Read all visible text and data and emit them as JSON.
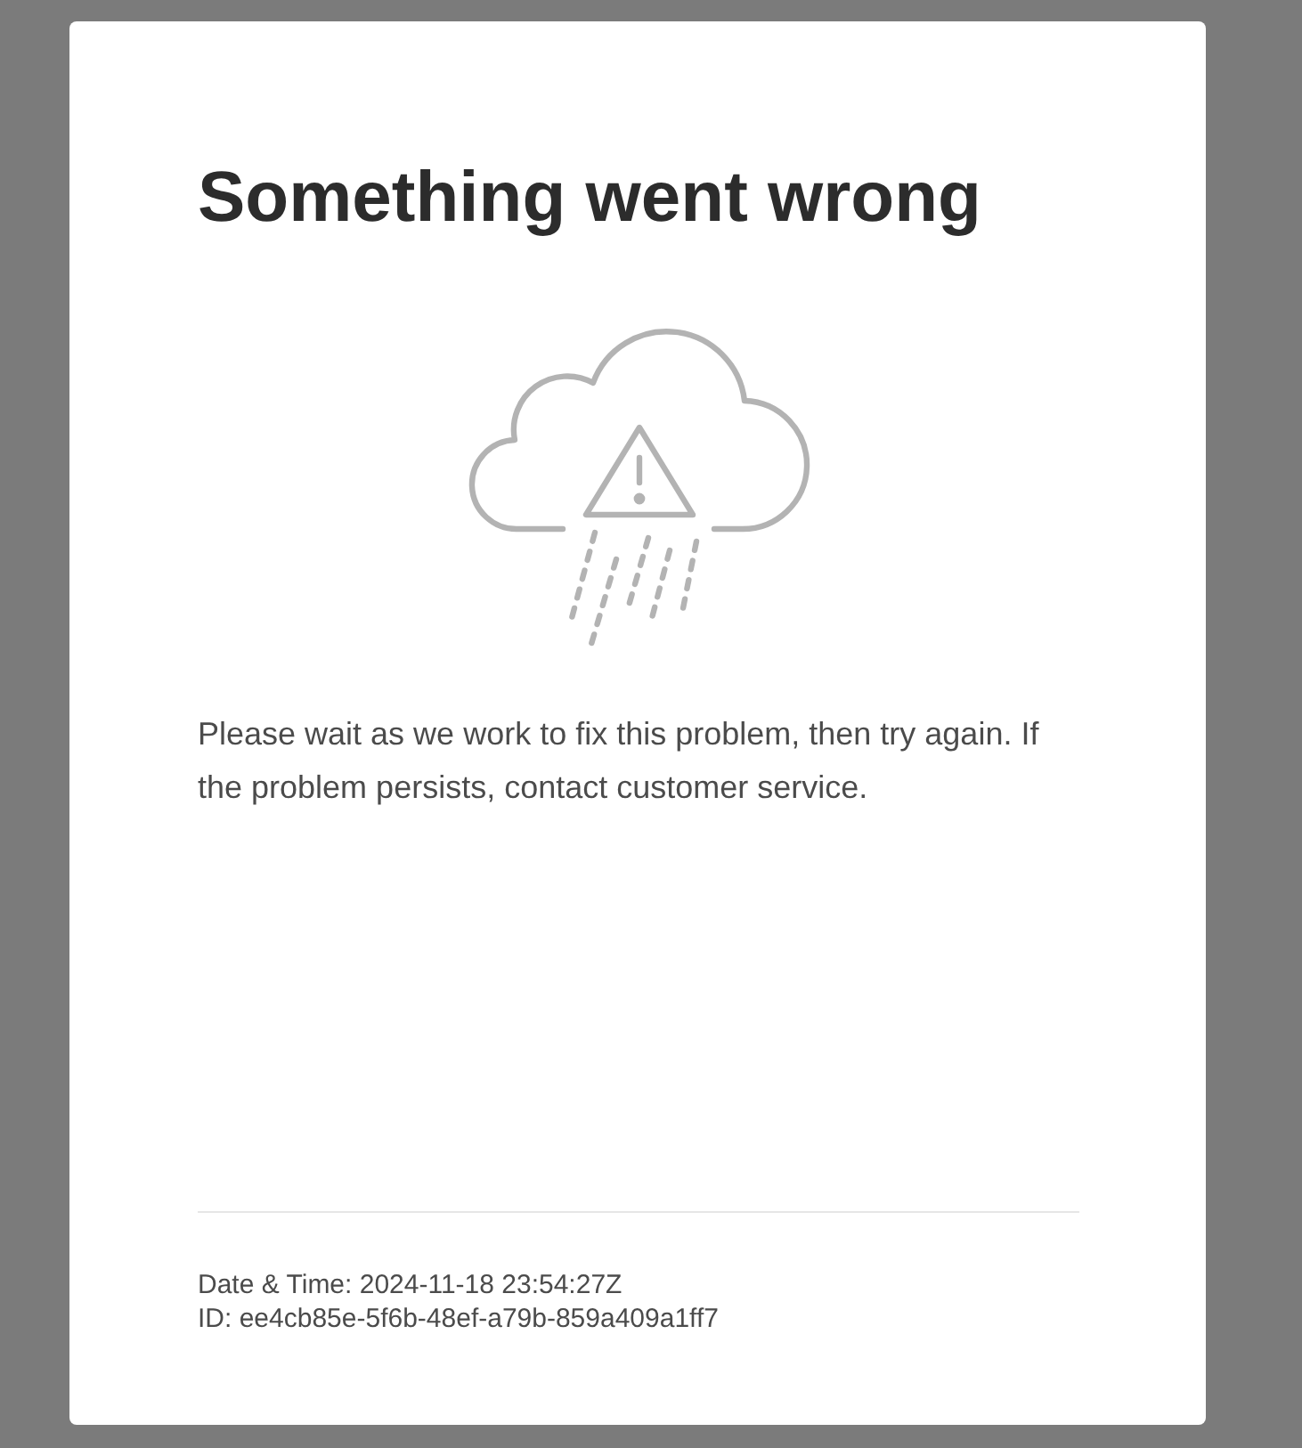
{
  "dialog": {
    "title": "Something went wrong",
    "message": "Please wait as we work to fix this problem, then try again. If the problem persists, contact customer service.",
    "details": [
      "Date & Time: 2024-11-18 23:54:27Z",
      "ID: ee4cb85e-5f6b-48ef-a79b-859a409a1ff7"
    ]
  }
}
